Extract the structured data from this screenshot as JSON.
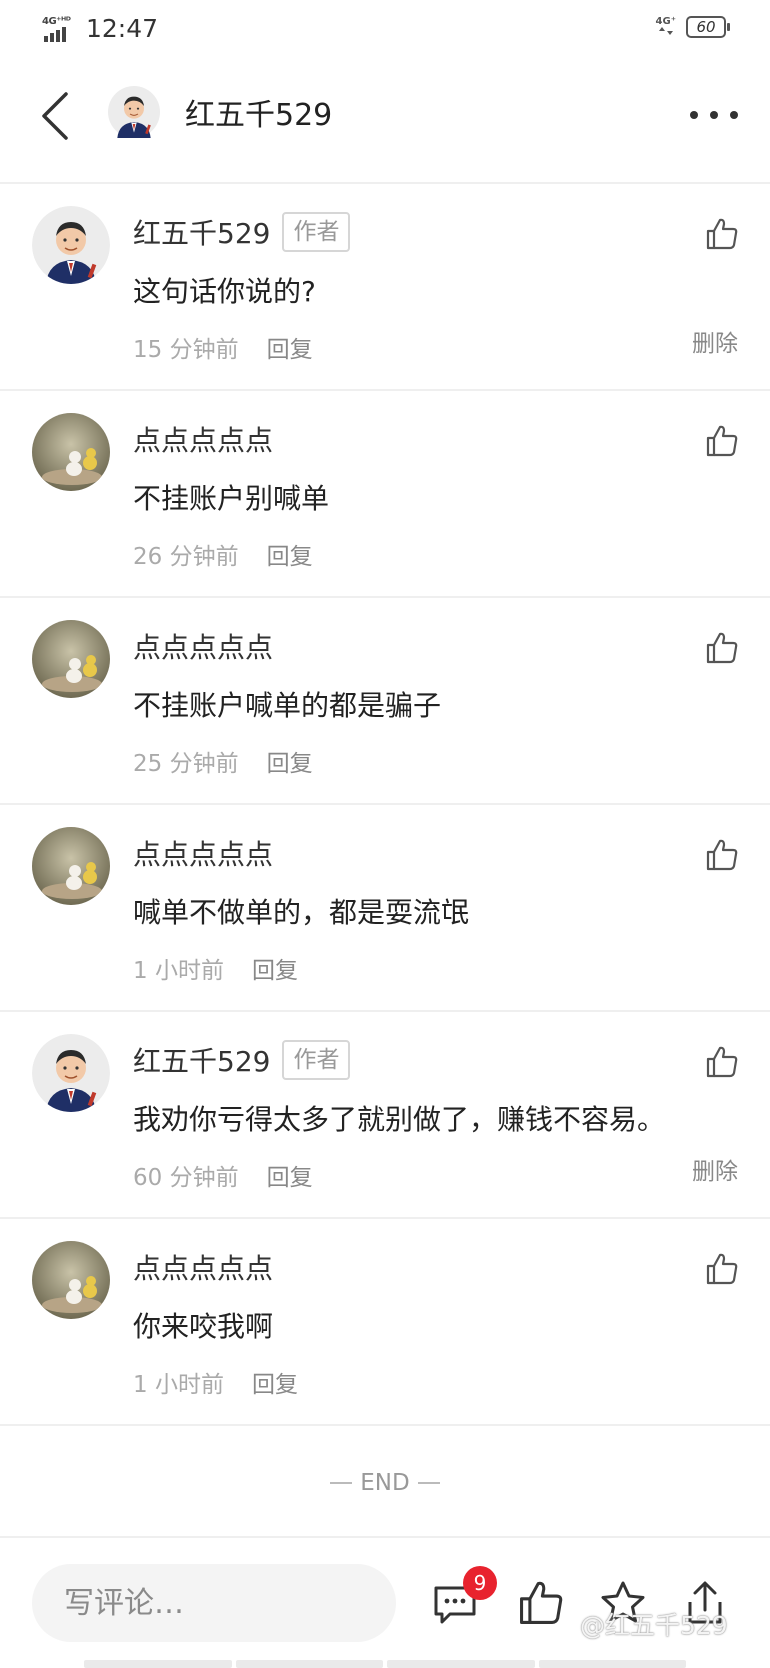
{
  "status_bar": {
    "network_left": "4G⁺ᴴᴰ",
    "time": "12:47",
    "network_right": "4G⁺",
    "battery": "60"
  },
  "header": {
    "title": "红五千529",
    "avatar_icon": "author-avatar-icon"
  },
  "comments": [
    {
      "name": "红五千529",
      "is_author": true,
      "author_label": "作者",
      "text": "这句话你说的?",
      "time": "15 分钟前",
      "reply_label": "回复",
      "delete_label": "删除"
    },
    {
      "name": "点点点点点",
      "is_author": false,
      "text": "不挂账户别喊单",
      "time": "26 分钟前",
      "reply_label": "回复"
    },
    {
      "name": "点点点点点",
      "is_author": false,
      "text": "不挂账户喊单的都是骗子",
      "time": "25 分钟前",
      "reply_label": "回复"
    },
    {
      "name": "点点点点点",
      "is_author": false,
      "text": "喊单不做单的，都是耍流氓",
      "time": "1 小时前",
      "reply_label": "回复"
    },
    {
      "name": "红五千529",
      "is_author": true,
      "author_label": "作者",
      "text": "我劝你亏得太多了就别做了，赚钱不容易。",
      "time": "60 分钟前",
      "reply_label": "回复",
      "delete_label": "删除"
    },
    {
      "name": "点点点点点",
      "is_author": false,
      "text": "你来咬我啊",
      "time": "1 小时前",
      "reply_label": "回复"
    }
  ],
  "end_label": "END",
  "bottom_bar": {
    "input_placeholder": "写评论…",
    "comment_count": "9",
    "watermark": "@红五千529"
  },
  "colors": {
    "badge_red": "#e8232e",
    "divider": "#efefef",
    "muted_text": "#aaaaaa",
    "input_bg": "#f4f4f4"
  }
}
